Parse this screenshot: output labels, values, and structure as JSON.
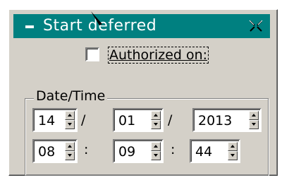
{
  "window": {
    "title": "Start deferred",
    "title_bar_color": "#008080",
    "minimize_icon": "dash-icon",
    "collapse_icon": "collapse-arrows-icon"
  },
  "authorized": {
    "label": "Authorized on:",
    "checked": false
  },
  "datetime": {
    "group_label": "Date/Time",
    "day": "14",
    "month": "01",
    "year": "2013",
    "date_sep1": "/",
    "date_sep2": "/",
    "hour": "08",
    "minute": "09",
    "second": "44",
    "time_sep1": ":",
    "time_sep2": ":"
  }
}
